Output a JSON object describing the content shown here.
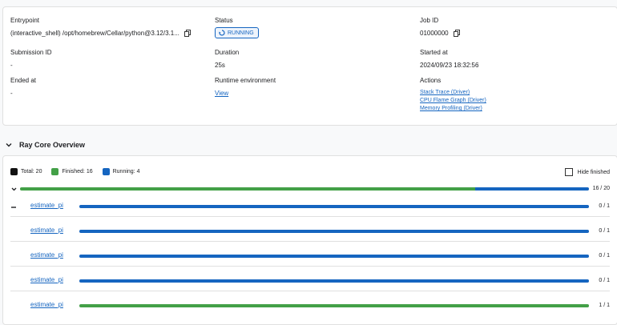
{
  "job": {
    "entrypoint": {
      "label": "Entrypoint",
      "value": "(interactive_shell) /opt/homebrew/Cellar/python@3.12/3.1..."
    },
    "status": {
      "label": "Status",
      "value": "RUNNING"
    },
    "job_id": {
      "label": "Job ID",
      "value": "01000000"
    },
    "submission_id": {
      "label": "Submission ID",
      "value": "-"
    },
    "duration": {
      "label": "Duration",
      "value": "25s"
    },
    "started_at": {
      "label": "Started at",
      "value": "2024/09/23 18:32:56"
    },
    "ended_at": {
      "label": "Ended at",
      "value": "-"
    },
    "runtime_env": {
      "label": "Runtime environment",
      "link": "View"
    },
    "actions": {
      "label": "Actions",
      "links": [
        "Stack Trace (Driver)",
        "CPU Flame Graph (Driver)",
        "Memory Profiling (Driver)"
      ]
    }
  },
  "overview": {
    "title": "Ray Core Overview",
    "legend": {
      "total": "Total: 20",
      "finished": "Finished: 16",
      "running": "Running: 4"
    },
    "hide_finished": "Hide finished",
    "summary": {
      "finished_fraction": 0.8,
      "running_fraction": 0.2,
      "count": "16 / 20"
    },
    "rows": [
      {
        "name": "estimate_pi",
        "count": "0 / 1",
        "finished_fraction": 0,
        "running_fraction": 1
      },
      {
        "name": "estimate_pi",
        "count": "0 / 1",
        "finished_fraction": 0,
        "running_fraction": 1
      },
      {
        "name": "estimate_pi",
        "count": "0 / 1",
        "finished_fraction": 0,
        "running_fraction": 1
      },
      {
        "name": "estimate_pi",
        "count": "0 / 1",
        "finished_fraction": 0,
        "running_fraction": 1
      },
      {
        "name": "estimate_pi",
        "count": "1 / 1",
        "finished_fraction": 1,
        "running_fraction": 0
      }
    ],
    "colors": {
      "total": "#111111",
      "finished": "#43a047",
      "running": "#1565c0"
    }
  }
}
